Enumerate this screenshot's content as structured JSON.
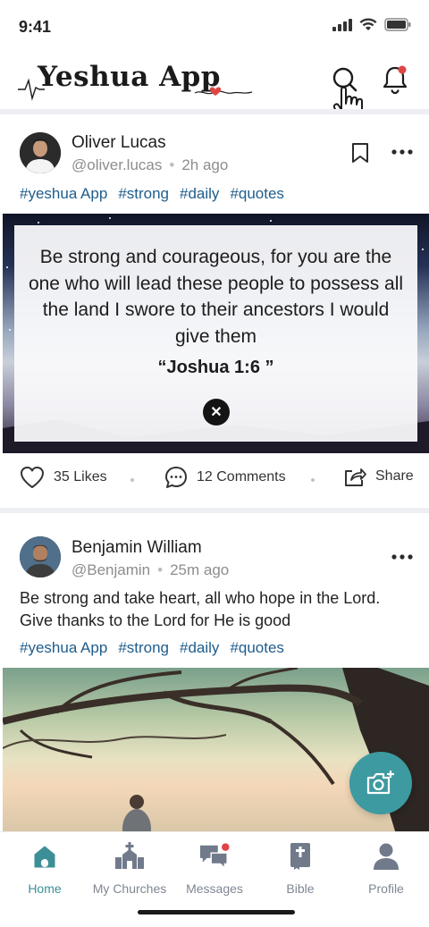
{
  "status_bar": {
    "time": "9:41"
  },
  "header": {
    "app_name": "Yeshua App",
    "accent_color": "#e04545"
  },
  "posts": [
    {
      "author": "Oliver Lucas",
      "handle": "@oliver.lucas",
      "time": "2h ago",
      "tags": [
        "#yeshua App",
        "#strong",
        "#daily",
        "#quotes"
      ],
      "quote": {
        "text": "Be strong and courageous, for you are the one who will lead these people to possess all the land I swore to their ancestors I would give them",
        "reference": "“Joshua 1:6 ”"
      },
      "likes": "35 Likes",
      "comments": "12 Comments",
      "share": "Share"
    },
    {
      "author": "Benjamin William",
      "handle": "@Benjamin",
      "time": "25m ago",
      "text": "Be strong and take heart, all who hope in the Lord. Give thanks to the Lord for He is good",
      "tags": [
        "#yeshua App",
        "#strong",
        "#daily",
        "#quotes"
      ]
    }
  ],
  "nav": [
    {
      "label": "Home",
      "icon": "home-icon",
      "active": true
    },
    {
      "label": "My Churches",
      "icon": "church-icon",
      "active": false
    },
    {
      "label": "Messages",
      "icon": "messages-icon",
      "active": false
    },
    {
      "label": "Bible",
      "icon": "bible-icon",
      "active": false
    },
    {
      "label": "Profile",
      "icon": "profile-icon",
      "active": false
    }
  ],
  "colors": {
    "tag": "#1f5d8c",
    "accent": "#3d9aa0",
    "nav_active": "#3d8f97"
  }
}
